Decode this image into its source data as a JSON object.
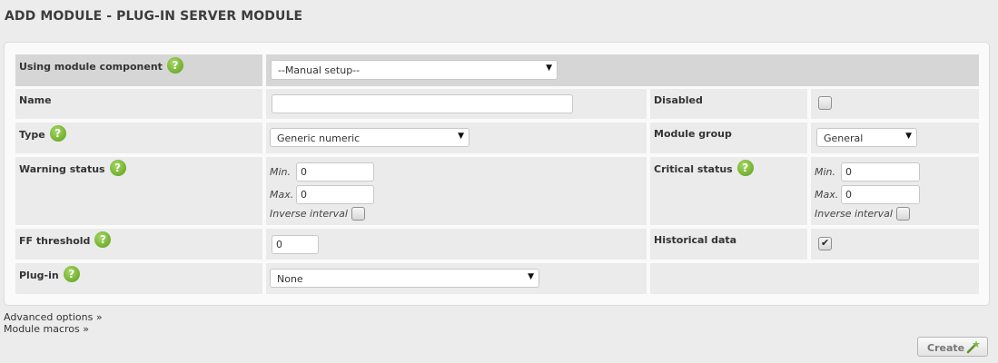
{
  "page": {
    "title": "ADD MODULE - PLUG-IN SERVER MODULE"
  },
  "form": {
    "component": {
      "label": "Using module component",
      "value": "--Manual setup--"
    },
    "name": {
      "label": "Name",
      "value": ""
    },
    "disabled": {
      "label": "Disabled",
      "checked": false
    },
    "type": {
      "label": "Type",
      "value": "Generic numeric"
    },
    "module_group": {
      "label": "Module group",
      "value": "General"
    },
    "warning": {
      "label": "Warning status",
      "min_label": "Min.",
      "min_value": "0",
      "max_label": "Max.",
      "max_value": "0",
      "inverse_label": "Inverse interval",
      "inverse_checked": false
    },
    "critical": {
      "label": "Critical status",
      "min_label": "Min.",
      "min_value": "0",
      "max_label": "Max.",
      "max_value": "0",
      "inverse_label": "Inverse interval",
      "inverse_checked": false
    },
    "ff_threshold": {
      "label": "FF threshold",
      "value": "0"
    },
    "historical": {
      "label": "Historical data",
      "checked": true
    },
    "plugin": {
      "label": "Plug-in",
      "value": "None"
    }
  },
  "links": {
    "advanced": "Advanced options »",
    "macros": "Module macros »"
  },
  "actions": {
    "create_label": "Create"
  },
  "icons": {
    "help": "help-icon",
    "dropdown": "chevron-down-icon",
    "create": "magic-wand-icon"
  },
  "colors": {
    "help_green": "#7cb83a",
    "header_gray": "#d6d6d6",
    "cell_gray": "#ebebeb"
  }
}
